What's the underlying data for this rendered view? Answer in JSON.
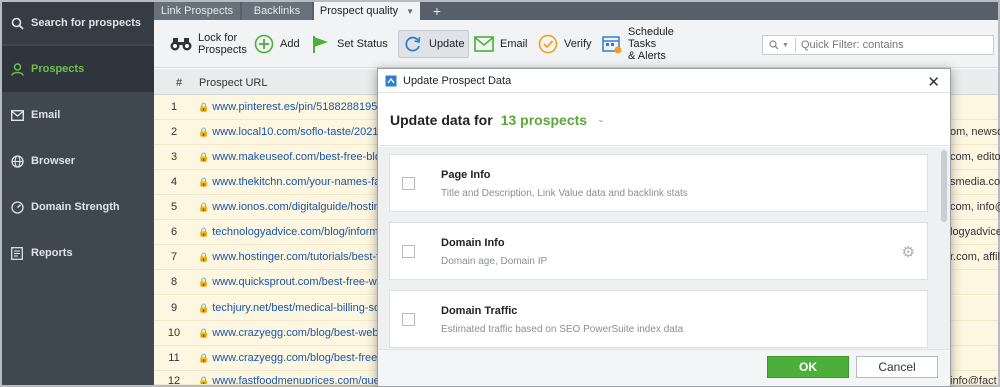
{
  "sidebar": {
    "search": "Search for prospects",
    "items": [
      {
        "label": "Prospects",
        "icon": "person-icon"
      },
      {
        "label": "Email",
        "icon": "envelope-icon"
      },
      {
        "label": "Browser",
        "icon": "globe-icon"
      },
      {
        "label": "Domain Strength",
        "icon": "gauge-icon"
      },
      {
        "label": "Reports",
        "icon": "report-icon"
      }
    ]
  },
  "tabs": [
    "Link Prospects",
    "Backlinks",
    "Prospect quality",
    "+"
  ],
  "toolbar": {
    "lock_line1": "Lock for",
    "lock_line2": "Prospects",
    "add": "Add",
    "set_status": "Set Status",
    "update": "Update",
    "email": "Email",
    "verify": "Verify",
    "schedule_line1": "Schedule",
    "schedule_line2": "Tasks",
    "schedule_line3": "& Alerts",
    "filter_placeholder": "Quick Filter: contains"
  },
  "table": {
    "headers": {
      "num": "#",
      "url": "Prospect URL"
    },
    "rows": [
      {
        "num": "1",
        "url": "www.pinterest.es/pin/518828819542...",
        "right": ""
      },
      {
        "num": "2",
        "url": "www.local10.com/soflo-taste/2021/1...",
        "right": "om, newsdes"
      },
      {
        "num": "3",
        "url": "www.makeuseof.com/best-free-blog...",
        "right": "com, editori"
      },
      {
        "num": "4",
        "url": "www.thekitchn.com/your-names-fav...",
        "right": "smedia.com"
      },
      {
        "num": "5",
        "url": "www.ionos.com/digitalguide/hosting/...",
        "right": "com, info@"
      },
      {
        "num": "6",
        "url": "technologyadvice.com/blog/informati...",
        "right": "logyadvice."
      },
      {
        "num": "7",
        "url": "www.hostinger.com/tutorials/best-fo...",
        "right": "r.com, affil"
      },
      {
        "num": "8",
        "url": "www.quicksprout.com/best-free-we...",
        "right": ""
      },
      {
        "num": "9",
        "url": "techjury.net/best/medical-billing-soft...",
        "right": ""
      },
      {
        "num": "10",
        "url": "www.crazyegg.com/blog/best-websi...",
        "right": ""
      },
      {
        "num": "11",
        "url": "www.crazyegg.com/blog/best-free-...",
        "right": ""
      },
      {
        "num": "12",
        "url": "www.fastfoodmenuprices.com/ques...",
        "right": "info@fact"
      }
    ]
  },
  "dialog": {
    "title": "Update Prospect Data",
    "heading": "Update data for",
    "count": "13 prospects",
    "items": [
      {
        "title": "Page Info",
        "desc": "Title and Description, Link Value data and backlink stats"
      },
      {
        "title": "Domain Info",
        "desc": "Domain age, Domain IP"
      },
      {
        "title": "Domain Traffic",
        "desc": "Estimated traffic based on SEO PowerSuite index data"
      }
    ],
    "ok": "OK",
    "cancel": "Cancel"
  },
  "colors": {
    "accent_green": "#5aa83a",
    "sidebar_bg": "#3f4750",
    "row_bg": "#fdf6e0",
    "link_blue": "#1a56a8"
  }
}
